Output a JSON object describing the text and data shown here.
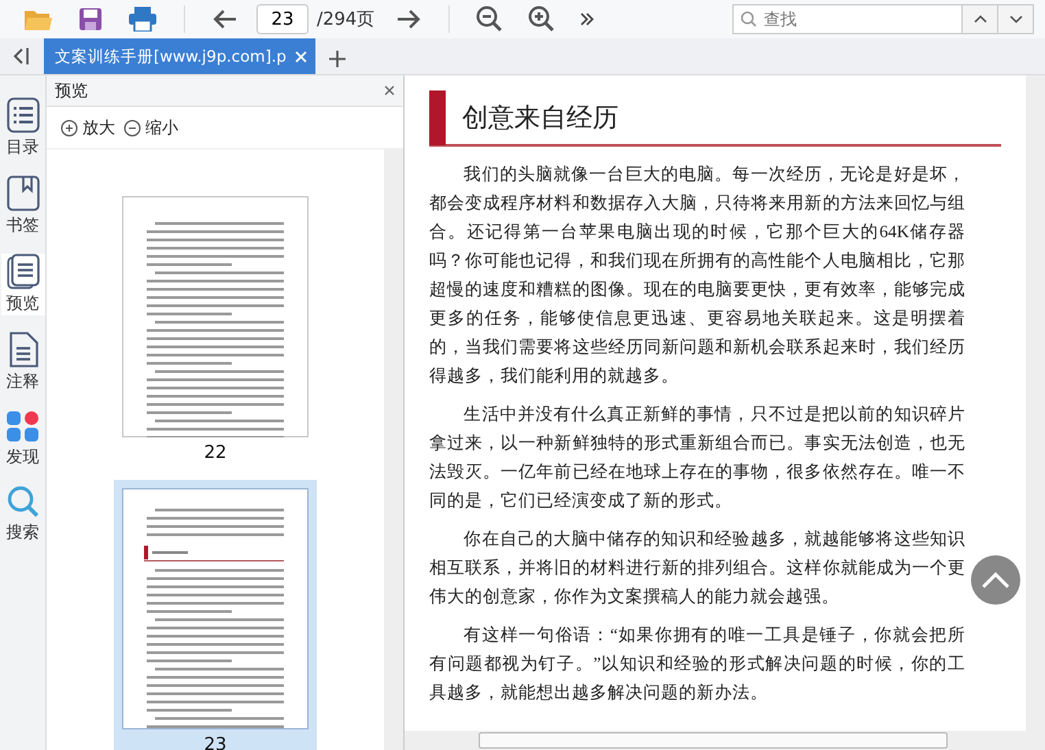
{
  "toolbar": {
    "page_input": "23",
    "page_total": "/294页",
    "search": {
      "placeholder": "查找"
    }
  },
  "tabs": [
    {
      "label": "文案训练手册[www.j9p.com].p",
      "selected": true
    }
  ],
  "sidebar": {
    "items": [
      {
        "label": "目录",
        "kind": "toc",
        "selected": false
      },
      {
        "label": "书签",
        "kind": "bookmark",
        "selected": false
      },
      {
        "label": "预览",
        "kind": "preview",
        "selected": true
      },
      {
        "label": "注释",
        "kind": "note",
        "selected": false
      },
      {
        "label": "发现",
        "kind": "discover",
        "selected": false
      },
      {
        "label": "搜索",
        "kind": "search",
        "selected": false
      }
    ]
  },
  "preview_panel": {
    "title": "预览",
    "zoom_in": "放大",
    "zoom_out": "缩小",
    "thumbnails": [
      {
        "label": "22",
        "selected": false,
        "kind": "text"
      },
      {
        "label": "23",
        "selected": true,
        "kind": "heading"
      }
    ]
  },
  "document": {
    "heading": "创意来自经历",
    "paragraphs": [
      "我们的头脑就像一台巨大的电脑。每一次经历，无论是好是坏，都会变成程序材料和数据存入大脑，只待将来用新的方法来回忆与组合。还记得第一台苹果电脑出现的时候，它那个巨大的64K储存器吗？你可能也记得，和我们现在所拥有的高性能个人电脑相比，它那超慢的速度和糟糕的图像。现在的电脑要更快，更有效率，能够完成更多的任务，能够使信息更迅速、更容易地关联起来。这是明摆着的，当我们需要将这些经历同新问题和新机会联系起来时，我们经历得越多，我们能利用的就越多。",
      "生活中并没有什么真正新鲜的事情，只不过是把以前的知识碎片拿过来，以一种新鲜独特的形式重新组合而已。事实无法创造，也无法毁灭。一亿年前已经在地球上存在的事物，很多依然存在。唯一不同的是，它们已经演变成了新的形式。",
      "你在自己的大脑中储存的知识和经验越多，就越能够将这些知识相互联系，并将旧的材料进行新的排列组合。这样你就能成为一个更伟大的创意家，你作为文案撰稿人的能力就会越强。",
      "有这样一句俗语：“如果你拥有的唯一工具是锤子，你就会把所有问题都视为钉子。”以知识和经验的形式解决问题的时候，你的工具越多，就能想出越多解决问题的新办法。"
    ]
  }
}
